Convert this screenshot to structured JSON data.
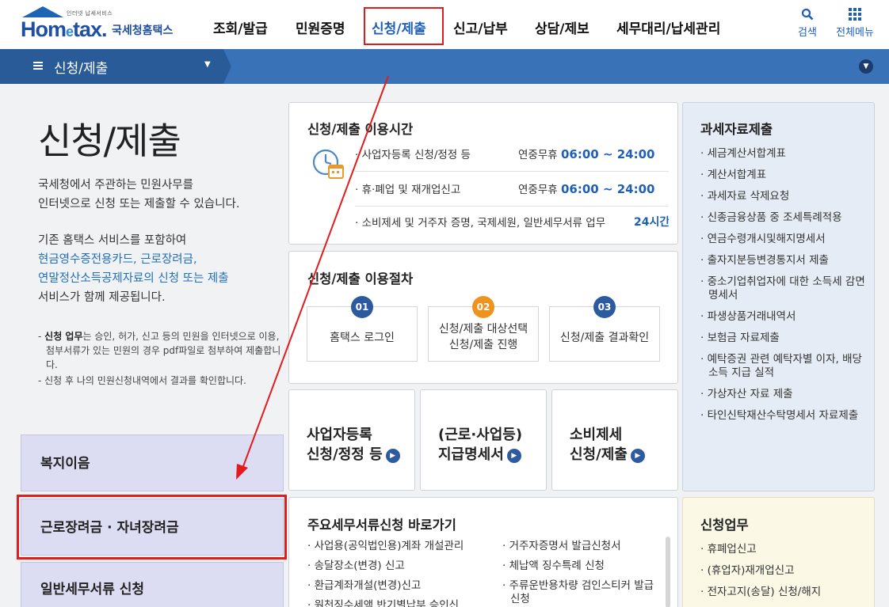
{
  "header": {
    "logo_sub": "인터넷 납세서비스",
    "logo_main": "Hom",
    "logo_e": "e",
    "logo_main2": "tax.",
    "logo_kr": "국세청홈택스",
    "nav": [
      "조회/발급",
      "민원증명",
      "신청/제출",
      "신고/납부",
      "상담/제보",
      "세무대리/납세관리"
    ],
    "search_label": "검색",
    "allmenu_label": "전체메뉴"
  },
  "subbar": {
    "menu_icon": "menu-icon",
    "title": "신청/제출",
    "caret_icon": "caret-down-icon"
  },
  "intro": {
    "title": "신청/제출",
    "line1": "국세청에서 주관하는 민원사무를",
    "line2": "인터넷으로 신청 또는 제출할 수 있습니다.",
    "line3": "기존 홈택스 서비스를 포함하여",
    "link1": "현금영수증전용카드, 근로장려금,",
    "link2": "연말정산소득공제자료의 신청 또는 제출",
    "line4": "서비스가 함께 제공됩니다.",
    "note1_bold": "신청 업무",
    "note1_rest": "는 승인, 허가, 신고 등의 민원을 인터넷으로 이용, 첨부서류가 있는 민원의 경우 pdf파일로 첨부하여 제출합니다.",
    "note1_prefix": "- ",
    "note2": "- 신청 후 나의 민원신청내역에서 결과를 확인합니다."
  },
  "leftnav": [
    "복지이음",
    "근로장려금 · 자녀장려금",
    "일반세무서류 신청"
  ],
  "hours": {
    "title": "신청/제출 이용시간",
    "rows": [
      {
        "label": "· 사업자등록 신청/정정 등",
        "prefix": "연중무휴",
        "time": "06:00 ~ 24:00"
      },
      {
        "label": "· 휴·폐업 및 재개업신고",
        "prefix": "연중무휴",
        "time": "06:00 ~ 24:00"
      },
      {
        "label": "· 소비제세 및 거주자 증명, 국제세원, 일반세무서류 업무",
        "prefix": "",
        "time": "24시간"
      }
    ]
  },
  "procedure": {
    "title": "신청/제출 이용절차",
    "steps": [
      {
        "num": "01",
        "line1": "홈택스 로그인",
        "line2": ""
      },
      {
        "num": "02",
        "line1": "신청/제출 대상선택",
        "line2": "신청/제출 진행"
      },
      {
        "num": "03",
        "line1": "신청/제출 결과확인",
        "line2": ""
      }
    ]
  },
  "quick": [
    {
      "line1": "사업자등록",
      "line2": "신청/정정 등"
    },
    {
      "line1": "(근로·사업등)",
      "line2": "지급명세서"
    },
    {
      "line1": "소비제세",
      "line2": "신청/제출"
    }
  ],
  "docs": {
    "title": "주요세무서류신청 바로가기",
    "col1": [
      "사업용(공익법인용)계좌 개설관리",
      "송달장소(변경) 신고",
      "환급계좌개설(변경)신고",
      "원천징수세액 반기별납부 승인신"
    ],
    "col2": [
      "거주자증명서 발급신청서",
      "체납액 징수특례 신청",
      "주류운반용차량 검인스티커 발급신청"
    ]
  },
  "taxdata": {
    "title": "과세자료제출",
    "items": [
      "세금계산서합계표",
      "계산서합계표",
      "과세자료 삭제요청",
      "신종금융상품 중 조세특례적용",
      "연금수령개시및해지명세서",
      "출자지분등변경통지서 제출",
      "중소기업취업자에 대한 소득세 감면명세서",
      "파생상품거래내역서",
      "보험금 자료제출",
      "예탁증권 관련 예탁자별 이자, 배당소득 지급 실적",
      "가상자산 자료 제출",
      "타인신탁재산수탁명세서 자료제출"
    ]
  },
  "apply": {
    "title": "신청업무",
    "items": [
      "휴폐업신고",
      "(휴업자)재개업신고",
      "전자고지(송달) 신청/해지"
    ]
  }
}
